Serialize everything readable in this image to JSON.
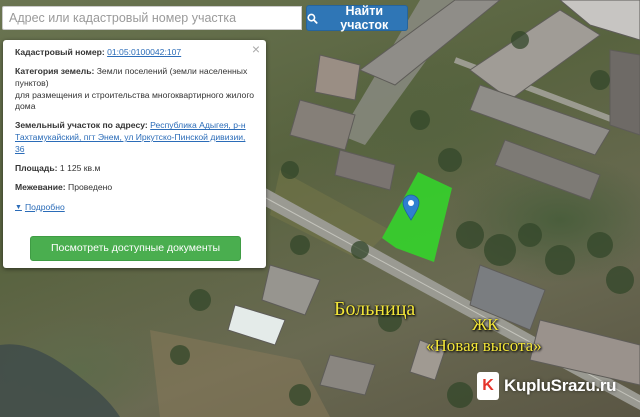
{
  "search": {
    "placeholder": "Адрес или кадастровый номер участка",
    "button_label": "Найти участок"
  },
  "panel": {
    "cadastral_label": "Кадастровый номер:",
    "cadastral_value": "01:05:0100042:107",
    "category_label": "Категория земель:",
    "category_value": "Земли поселений (земли населенных пунктов)",
    "category_purpose": "для размещения и строительства многоквартирного жилого дома",
    "address_label": "Земельный участок по адресу:",
    "address_value": "Республика Адыгея, р-н Тахтамукайский, пгт Энем, ул Иркутско-Пинской дивизии, 36",
    "area_label": "Площадь:",
    "area_value": "1 125 кв.м",
    "survey_label": "Межевание:",
    "survey_value": "Проведено",
    "more_label": "Подробно",
    "docs_button": "Посмотреть доступные документы",
    "close_glyph": "×"
  },
  "map": {
    "label_hospital": "Больница",
    "label_zhk": "ЖК",
    "label_zhk_name": "«Новая высота»",
    "parcel_color": "#33d62a",
    "marker_color": "#2f7fd0"
  },
  "watermark": {
    "logo_letter": "K",
    "text": "KupluSrazu.ru"
  }
}
